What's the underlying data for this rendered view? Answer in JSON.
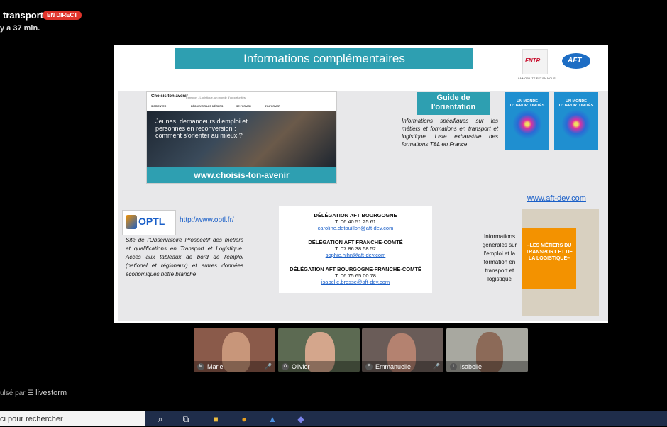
{
  "stream": {
    "title": "transport",
    "live_badge": "EN DIRECT",
    "subtitle": "y a 37 min."
  },
  "slide": {
    "header": "Informations complémentaires",
    "fntr_logo": "FNTR",
    "fntr_tagline": "LA MOBILITÉ EST EN NOUS",
    "aft_logo": "AFT",
    "website": {
      "logo": "Choisis ton avenir",
      "tagline": "Transport - Logistique, un monde d'opportunités",
      "nav": [
        "S'ORIENTER",
        "DÉCOUVRIR LES MÉTIERS",
        "SE FORMER",
        "S'INFORMER"
      ],
      "hero_text": "Jeunes, demandeurs d'emploi et personnes en reconversion : comment s'orienter au mieux ?",
      "url": "www.choisis-ton-avenir"
    },
    "guide": {
      "title_line1": "Guide de",
      "title_line2": "l'orientation",
      "text": "Informations spécifiques sur les métiers et formations en transport et logistique. Liste exhaustive des formations T&L en France",
      "book_title": "UN MONDE D'OPPORTUNITÉS"
    },
    "aftdev_url": "www.aft-dev.com",
    "optl": {
      "logo": "OPTL",
      "url": "http://www.optl.fr/",
      "text": "Site de l'Observatoire Prospectif des métiers et qualifications en Transport et Logistique. Accès aux tableaux de bord de l'emploi (national et régionaux) et autres données économiques notre branche"
    },
    "delegations": [
      {
        "name": "DÉLÉGATION AFT BOURGOGNE",
        "phone": "T. 06 40 51 25 61",
        "email": "caroline.detouillon@aft-dev.com"
      },
      {
        "name": "DÉLÉGATION AFT FRANCHE-COMTÉ",
        "phone": "T. 07 86 38 58 52",
        "email": "sophie.hihn@aft-dev.com"
      },
      {
        "name": "DÉLÉGATION AFT BOURGOGNE-FRANCHE-COMTÉ",
        "phone": "T. 06 75 65 00 78",
        "email": "isabelle.brosse@aft-dev.com"
      }
    ],
    "info_right": "Informations générales sur l'emploi et la formation en transport et logistique",
    "metiers_text": "–LES MÉTIERS DU TRANSPORT ET DE LA LOGISTIQUE–"
  },
  "participants": [
    {
      "initial": "M",
      "name": "Marie",
      "muted": true
    },
    {
      "initial": "O",
      "name": "Olivier",
      "muted": false
    },
    {
      "initial": "E",
      "name": "Emmanuelle",
      "muted": true
    },
    {
      "initial": "I",
      "name": "Isabelle",
      "muted": false
    }
  ],
  "footer": {
    "powered_by": "ulsé par",
    "brand": "livestorm"
  },
  "taskbar": {
    "search_placeholder": "ci pour rechercher"
  }
}
